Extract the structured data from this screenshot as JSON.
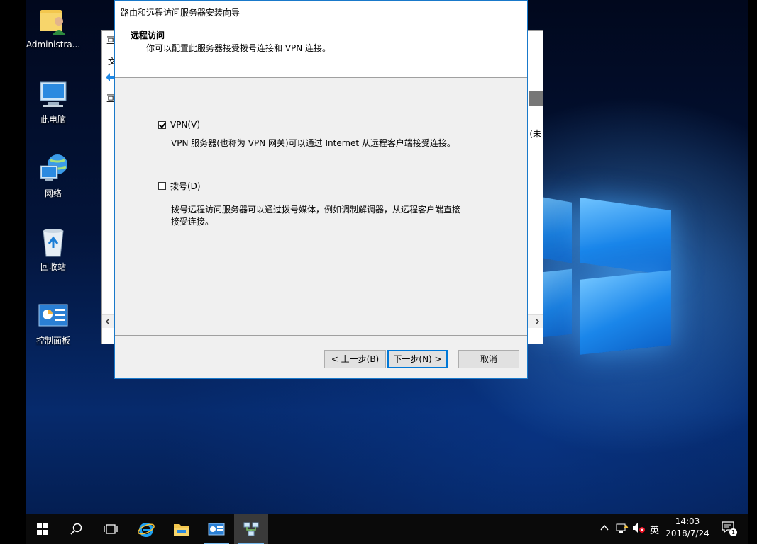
{
  "desktop": {
    "icons": [
      {
        "label": "Administra..."
      },
      {
        "label": "此电脑"
      },
      {
        "label": "网络"
      },
      {
        "label": "回收站"
      },
      {
        "label": "控制面板"
      }
    ]
  },
  "background_window": {
    "fragments": [
      "亘",
      "文",
      "亘",
      "亡 (未"
    ]
  },
  "wizard": {
    "title": "路由和远程访问服务器安装向导",
    "header_title": "远程访问",
    "header_subtitle": "你可以配置此服务器接受拨号连接和 VPN 连接。",
    "options": [
      {
        "label": "VPN(V)",
        "checked": true,
        "description": "VPN 服务器(也称为 VPN 网关)可以通过 Internet 从远程客户端接受连接。"
      },
      {
        "label": "拨号(D)",
        "checked": false,
        "description_line1": "拨号远程访问服务器可以通过拨号媒体，例如调制解调器，从远程客户端直接",
        "description_line2": "接受连接。"
      }
    ],
    "buttons": {
      "back": "< 上一步(B)",
      "next": "下一步(N) >",
      "cancel": "取消"
    }
  },
  "taskbar": {
    "ime": "英",
    "time": "14:03",
    "date": "2018/7/24",
    "notification_count": "1"
  }
}
